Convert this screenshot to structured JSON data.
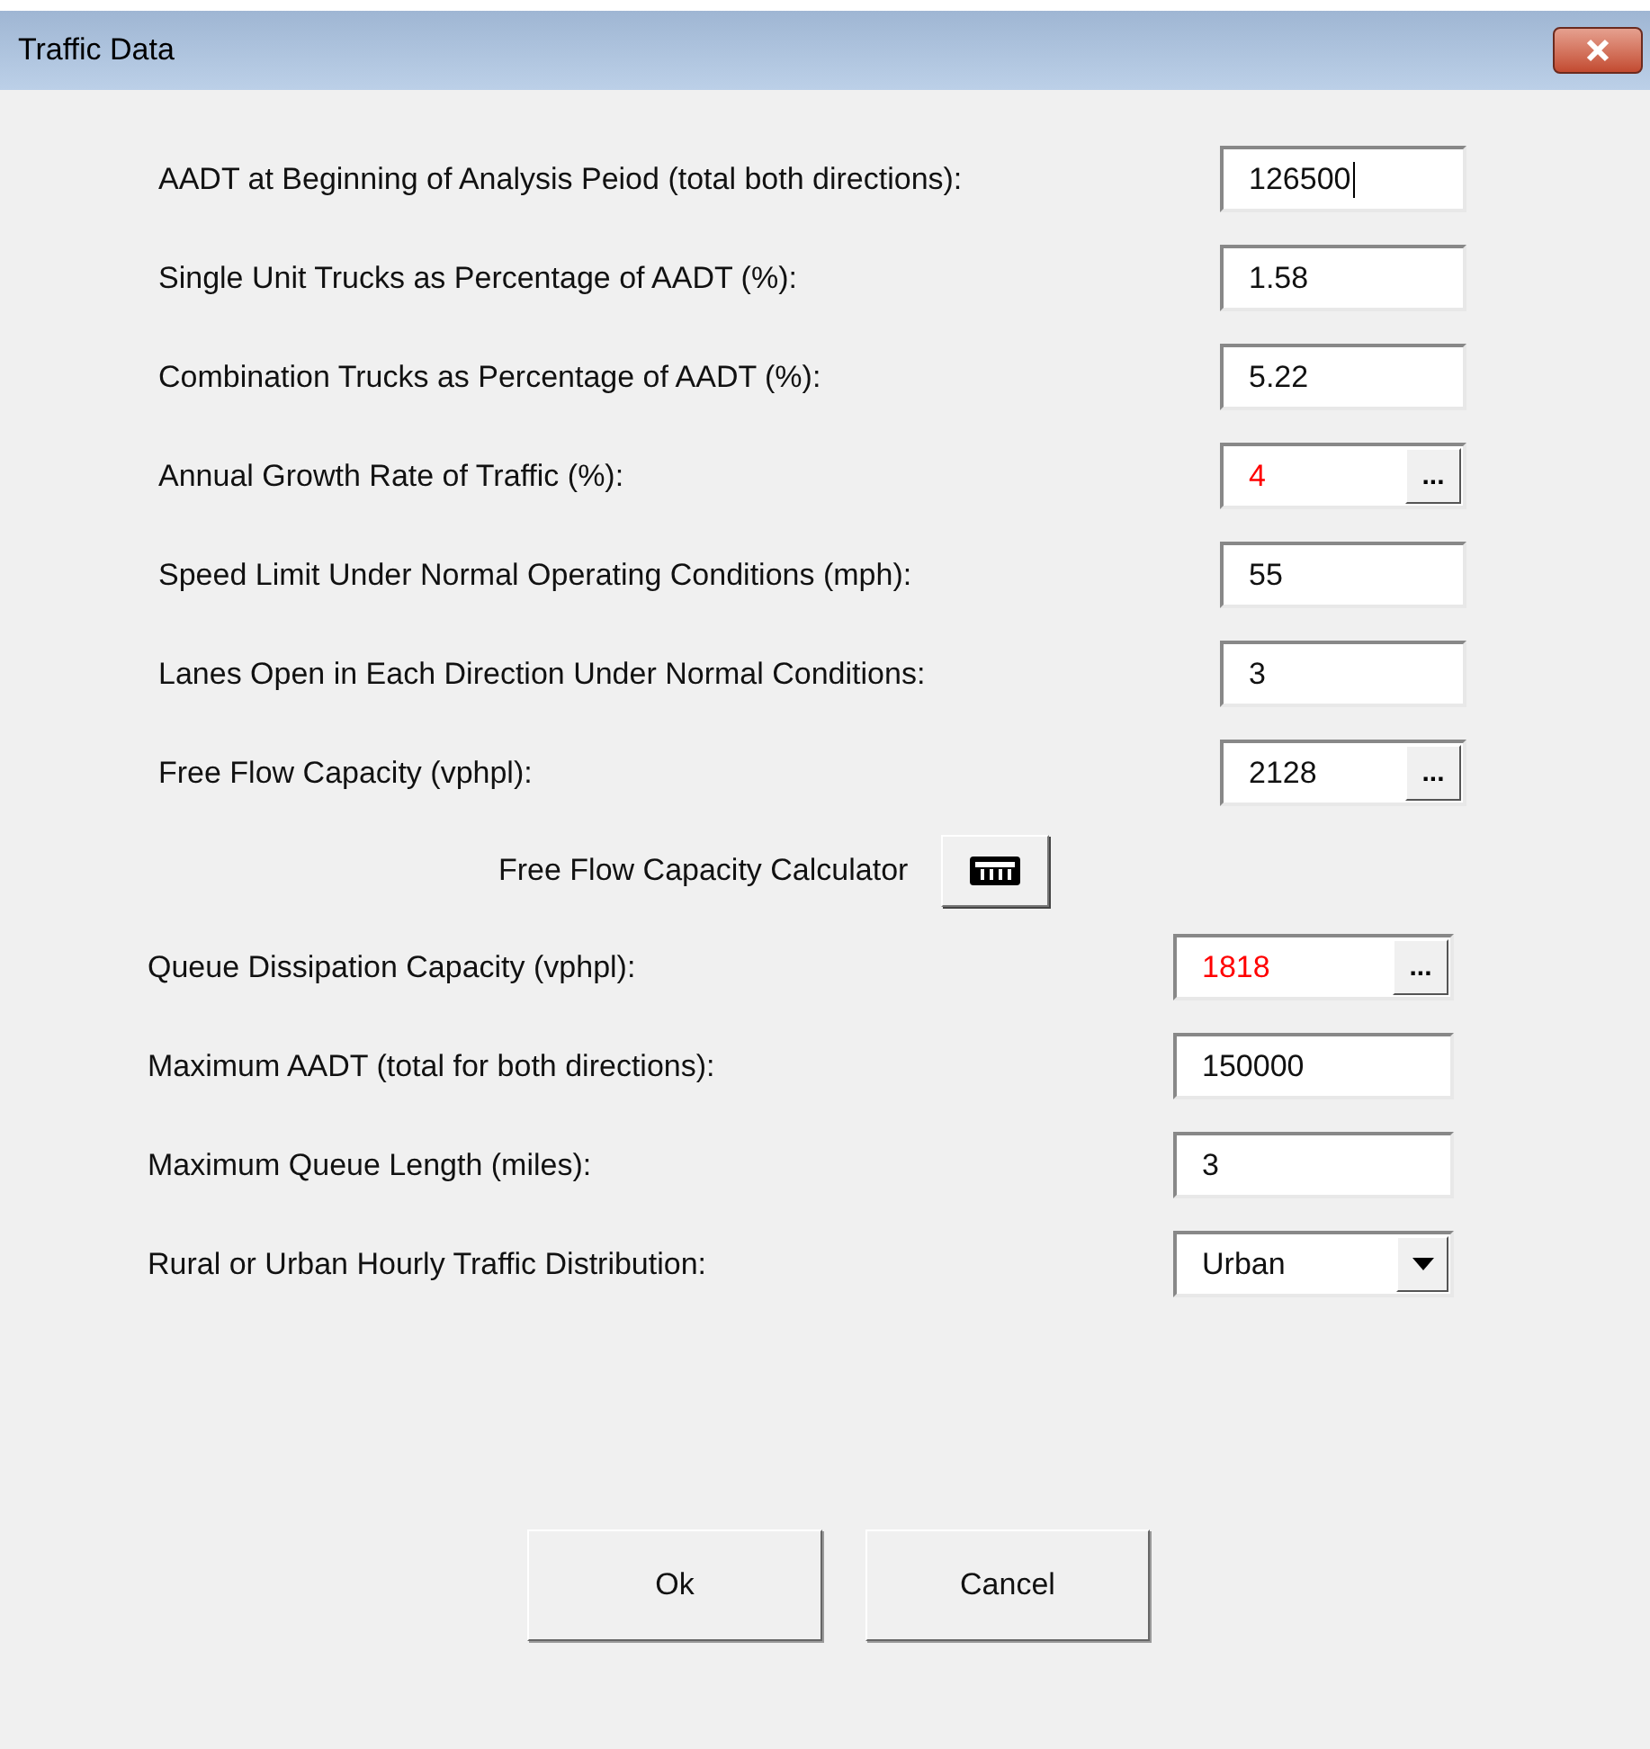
{
  "window": {
    "title": "Traffic Data"
  },
  "fields": [
    {
      "label": "AADT at Beginning of Analysis Peiod (total both directions):",
      "value": "126500",
      "kind": "text",
      "highlighted": false,
      "focused": true
    },
    {
      "label": "Single Unit Trucks as Percentage of AADT (%):",
      "value": "1.58",
      "kind": "text",
      "highlighted": false,
      "focused": false
    },
    {
      "label": "Combination Trucks as Percentage of AADT (%):",
      "value": "5.22",
      "kind": "text",
      "highlighted": false,
      "focused": false
    },
    {
      "label": "Annual Growth Rate of Traffic (%):",
      "value": "4",
      "kind": "browse",
      "button": "...",
      "highlighted": true,
      "focused": false
    },
    {
      "label": "Speed Limit Under Normal Operating Conditions (mph):",
      "value": "55",
      "kind": "text",
      "highlighted": false,
      "focused": false
    },
    {
      "label": "Lanes Open in Each Direction Under Normal Conditions:",
      "value": "3",
      "kind": "text",
      "highlighted": false,
      "focused": false
    },
    {
      "label": "Free Flow Capacity (vphpl):",
      "value": "2128",
      "kind": "browse",
      "button": "...",
      "highlighted": false,
      "focused": false
    }
  ],
  "calculator": {
    "label": "Free Flow Capacity Calculator"
  },
  "fields_2": [
    {
      "label": "Queue Dissipation Capacity (vphpl):",
      "value": "1818",
      "kind": "browse",
      "button": "...",
      "highlighted": true,
      "focused": false
    },
    {
      "label": "Maximum AADT (total for both directions):",
      "value": "150000",
      "kind": "text",
      "highlighted": false,
      "focused": false
    },
    {
      "label": "Maximum Queue Length (miles):",
      "value": "3",
      "kind": "text",
      "highlighted": false,
      "focused": false
    },
    {
      "label": "Rural or Urban Hourly Traffic Distribution:",
      "value": "Urban",
      "kind": "dropdown",
      "highlighted": false,
      "focused": false
    }
  ],
  "buttons": [
    "Ok",
    "Cancel"
  ]
}
